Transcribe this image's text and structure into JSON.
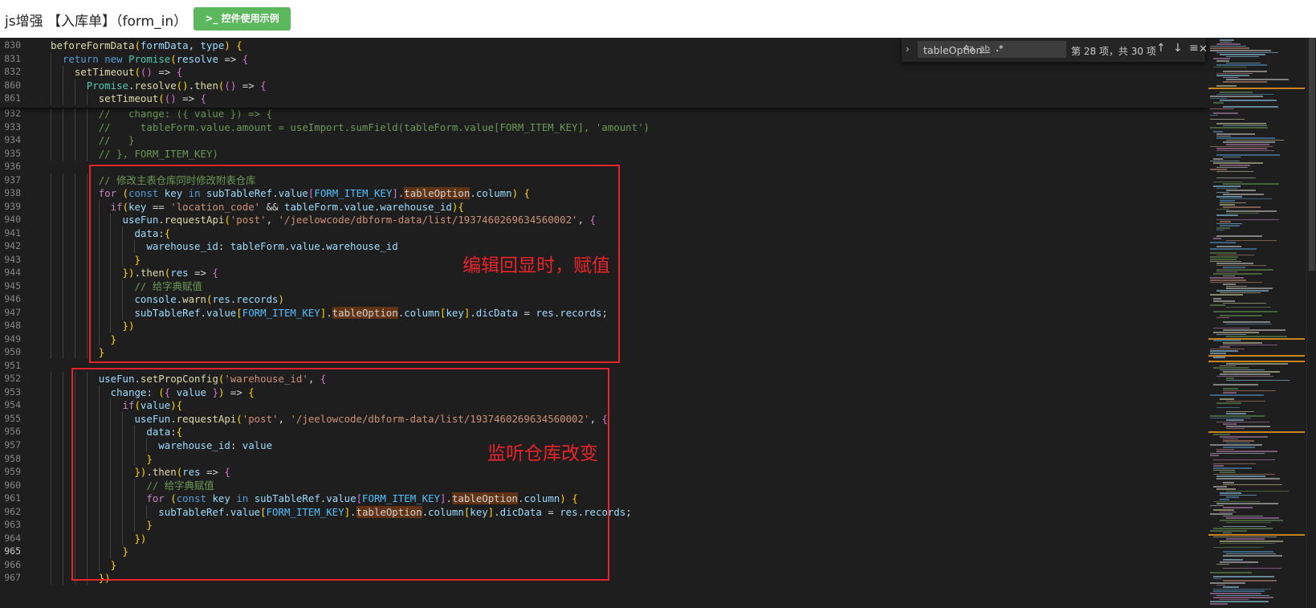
{
  "header": {
    "title": "js增强 【入库单】（form_in）",
    "demo_button": ">_ 控件使用示例"
  },
  "find_widget": {
    "query": "tableOption",
    "toggle": "›",
    "opt_case": "Aa",
    "opt_word": "ab",
    "opt_regex": ".*",
    "count": "第 28 项，共 30 项",
    "prev": "↑",
    "next": "↓",
    "selection": "≡",
    "close": "✕"
  },
  "annotations": {
    "edit_echo": "编辑回显时，赋值",
    "listen_warehouse": "监听仓库改变"
  },
  "colors": {
    "annotation_red": "#e8242a",
    "button_green": "#5cb85c",
    "editor_bg": "#1e1e1e"
  },
  "code": {
    "sticky": [
      {
        "ln": "830",
        "t": "beforeFormData(formData, type) {"
      },
      {
        "ln": "831",
        "t": "  return new Promise(resolve => {"
      },
      {
        "ln": "832",
        "t": "    setTimeout(() => {"
      },
      {
        "ln": "860",
        "t": "      Promise.resolve().then(() => {"
      },
      {
        "ln": "861",
        "t": "        setTimeout(() => {"
      }
    ],
    "lines": [
      {
        "ln": "932",
        "t": "        //   change: ({ value }) => {"
      },
      {
        "ln": "933",
        "t": "        //     tableForm.value.amount = useImport.sumField(tableForm.value[FORM_ITEM_KEY], 'amount')"
      },
      {
        "ln": "934",
        "t": "        //   }"
      },
      {
        "ln": "935",
        "t": "        // }, FORM_ITEM_KEY)"
      },
      {
        "ln": "936",
        "t": ""
      },
      {
        "ln": "937",
        "t": "        // 修改主表仓库同时修改附表仓库"
      },
      {
        "ln": "938",
        "t": "        for (const key in subTableRef.value[FORM_ITEM_KEY].tableOption.column) {"
      },
      {
        "ln": "939",
        "t": "          if(key == 'location_code' && tableForm.value.warehouse_id){"
      },
      {
        "ln": "940",
        "t": "            useFun.requestApi('post', '/jeelowcode/dbform-data/list/1937460269634560002', {"
      },
      {
        "ln": "941",
        "t": "              data:{"
      },
      {
        "ln": "942",
        "t": "                warehouse_id: tableForm.value.warehouse_id"
      },
      {
        "ln": "943",
        "t": "              }"
      },
      {
        "ln": "944",
        "t": "            }).then(res => {"
      },
      {
        "ln": "945",
        "t": "              // 给字典赋值"
      },
      {
        "ln": "946",
        "t": "              console.warn(res.records)"
      },
      {
        "ln": "947",
        "t": "              subTableRef.value[FORM_ITEM_KEY].tableOption.column[key].dicData = res.records;"
      },
      {
        "ln": "948",
        "t": "            })"
      },
      {
        "ln": "949",
        "t": "          }"
      },
      {
        "ln": "950",
        "t": "        }"
      },
      {
        "ln": "951",
        "t": ""
      },
      {
        "ln": "952",
        "t": "        useFun.setPropConfig('warehouse_id', {"
      },
      {
        "ln": "953",
        "t": "          change: ({ value }) => {"
      },
      {
        "ln": "954",
        "t": "            if(value){"
      },
      {
        "ln": "955",
        "t": "              useFun.requestApi('post', '/jeelowcode/dbform-data/list/1937460269634560002', {"
      },
      {
        "ln": "956",
        "t": "                data:{"
      },
      {
        "ln": "957",
        "t": "                  warehouse_id: value"
      },
      {
        "ln": "958",
        "t": "                }"
      },
      {
        "ln": "959",
        "t": "              }).then(res => {"
      },
      {
        "ln": "960",
        "t": "                // 给字典赋值"
      },
      {
        "ln": "961",
        "t": "                for (const key in subTableRef.value[FORM_ITEM_KEY].tableOption.column) {"
      },
      {
        "ln": "962",
        "t": "                  subTableRef.value[FORM_ITEM_KEY].tableOption.column[key].dicData = res.records;"
      },
      {
        "ln": "963",
        "t": "                }"
      },
      {
        "ln": "964",
        "t": "              })"
      },
      {
        "ln": "965",
        "t": "            }"
      },
      {
        "ln": "966",
        "t": "          }"
      },
      {
        "ln": "967",
        "t": "        })"
      }
    ]
  }
}
